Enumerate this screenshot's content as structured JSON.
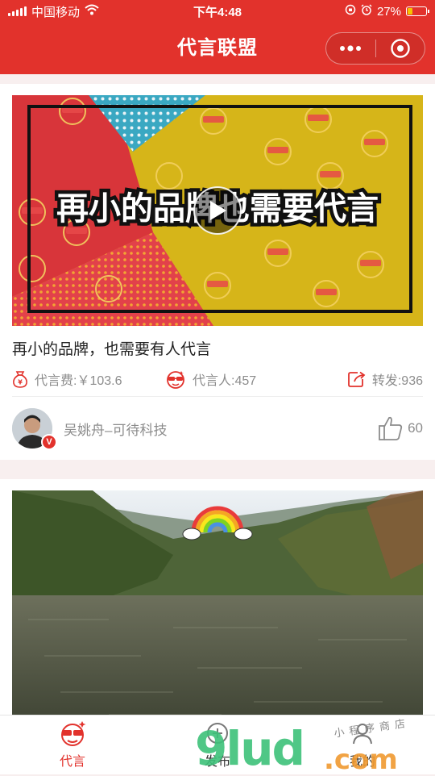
{
  "status_bar": {
    "carrier": "中国移动",
    "time": "下午4:48",
    "battery": "27%",
    "battery_level": 0.27,
    "icons": [
      "signal-icon",
      "wifi-icon",
      "orientation-lock-icon",
      "alarm-icon",
      "battery-icon"
    ]
  },
  "nav": {
    "title": "代言联盟",
    "capsule_icons": [
      "more-dots-icon",
      "close-target-icon"
    ]
  },
  "colors": {
    "brand": "#e2322c",
    "text_secondary": "#8c8c8c",
    "page_bg": "#f7eeee"
  },
  "feed": [
    {
      "type": "video",
      "cover_text": "再小的品牌也需要代言",
      "title": "再小的品牌，也需要有人代言",
      "fee_label": "代言费:￥103.6",
      "reps_label": "代言人:457",
      "shares_label": "转发:936",
      "author": "吴姚舟–可待科技",
      "verified_badge": "V",
      "likes": "60"
    },
    {
      "type": "photo",
      "subject": "lake-with-rainbow"
    }
  ],
  "tabs": [
    {
      "label": "代言",
      "active": true,
      "icon": "mascot-icon"
    },
    {
      "label": "发布",
      "active": false,
      "icon": "publish-icon"
    },
    {
      "label": "我的",
      "active": false,
      "icon": "profile-icon"
    }
  ],
  "watermark": {
    "main": "9lud",
    "suffix": ".com",
    "tagline": "小程序商店"
  }
}
